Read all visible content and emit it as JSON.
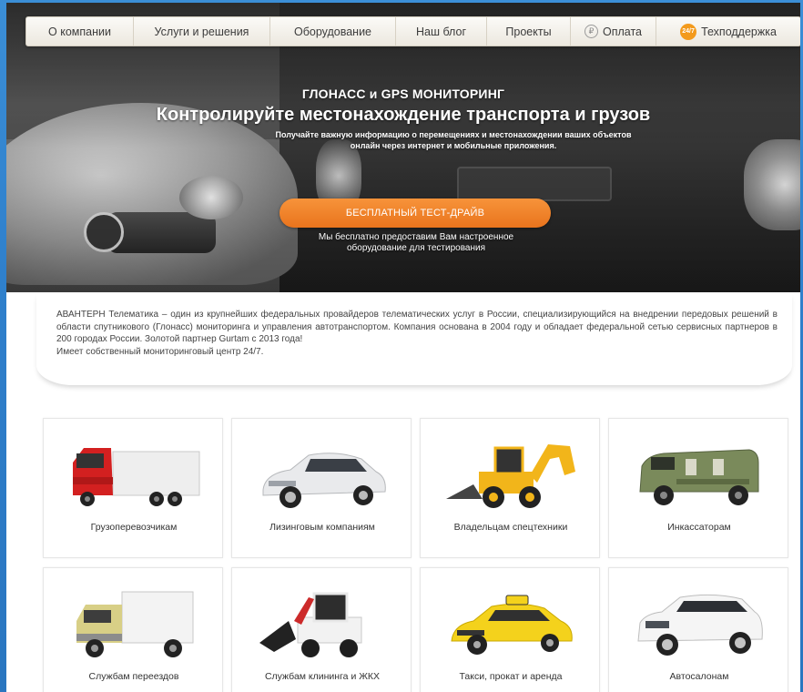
{
  "nav": {
    "items": [
      {
        "label": "О компании"
      },
      {
        "label": "Услуги и решения"
      },
      {
        "label": "Оборудование"
      },
      {
        "label": "Наш блог"
      },
      {
        "label": "Проекты"
      },
      {
        "label": "Оплата",
        "icon": "payment-icon",
        "icon_text": "₽"
      },
      {
        "label": "Техподдержка",
        "icon": "support-24-7-icon",
        "icon_text": "24/7"
      }
    ]
  },
  "hero": {
    "subtitle": "ГЛОНАСС и GPS МОНИТОРИНГ",
    "title": "Контролируйте местонахождение транспорта и грузов",
    "desc_line1": "Получайте важную информацию о перемещениях и местонахождении ваших объектов",
    "desc_line2": "онлайн через интернет и мобильные приложения.",
    "cta_label": "БЕСПЛАТНЫЙ ТЕСТ-ДРАЙВ",
    "cta_note_line1": "Мы бесплатно предоставим Вам настроенное",
    "cta_note_line2": "оборудование для тестирования"
  },
  "about": {
    "text": "АВАНТЕРН Телематика – один из крупнейших федеральных провайдеров телематических услуг в России, специализирующийся на внедрении передовых решений в области спутникового (Глонасс) мониторинга и управления автотранспортом. Компания основана в 2004 году и обладает федеральной сетью сервисных партнеров в 200 городах России. Золотой партнер Gurtam с 2013 года!",
    "text2": "Имеет собственный мониторинговый центр 24/7."
  },
  "cards": [
    {
      "label": "Грузоперевозчикам",
      "icon": "truck-icon"
    },
    {
      "label": "Лизинговым компаниям",
      "icon": "car-icon"
    },
    {
      "label": "Владельцам спецтехники",
      "icon": "excavator-icon"
    },
    {
      "label": "Инкассаторам",
      "icon": "armored-van-icon"
    },
    {
      "label": "Службам переездов",
      "icon": "moving-van-icon"
    },
    {
      "label": "Службам клининга и ЖКХ",
      "icon": "skid-loader-icon"
    },
    {
      "label": "Такси, прокат и аренда",
      "icon": "taxi-icon"
    },
    {
      "label": "Автосалонам",
      "icon": "suv-icon"
    }
  ],
  "colors": {
    "frame": "#2f80cc",
    "cta": "#f08526",
    "support_icon": "#f39a1c"
  }
}
